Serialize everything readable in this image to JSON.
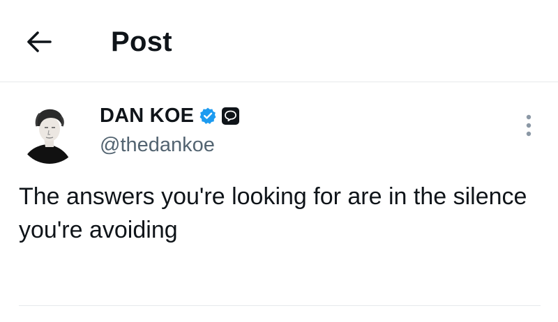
{
  "header": {
    "title": "Post",
    "back_icon": "arrow-left-icon"
  },
  "post": {
    "author": {
      "display_name": "DAN KOE",
      "handle": "@thedankoe",
      "verified_icon": "verified-badge-icon",
      "verified_color": "#1d9bf0",
      "affiliate_icon": "speech-bubble-badge-icon"
    },
    "text": "The answers you're looking for are in the silence you're avoiding",
    "more_icon": "more-vertical-icon"
  },
  "colors": {
    "text_primary": "#0f1419",
    "text_secondary": "#536471",
    "divider": "#e6e9eb",
    "accent": "#1d9bf0"
  }
}
